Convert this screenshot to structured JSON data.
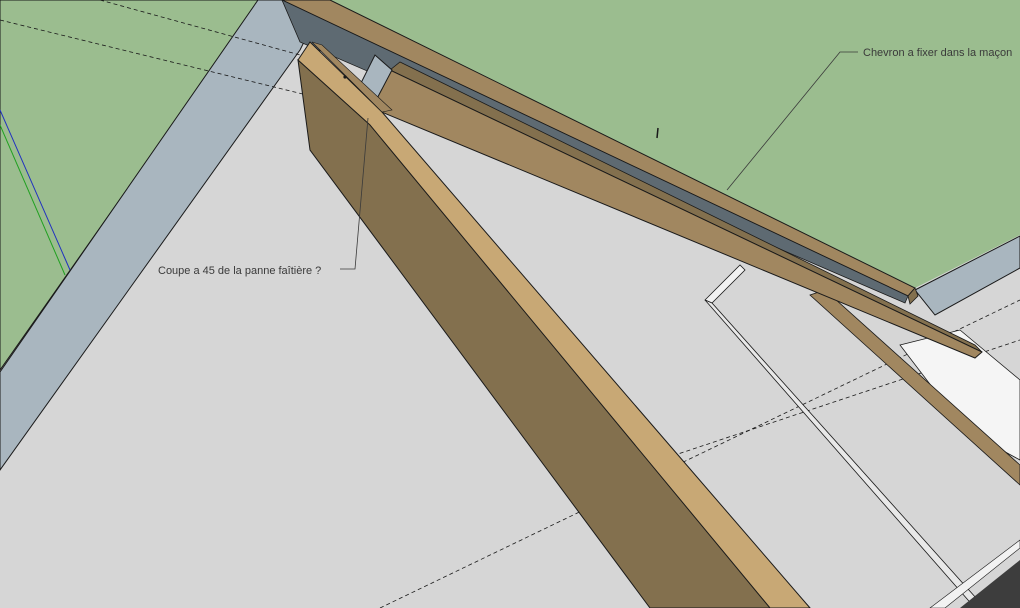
{
  "annotations": {
    "chevron_label": "Chevron a fixer dans la maçon",
    "cut_label": "Coupe a  45 de la panne faîtière ?"
  },
  "colors": {
    "ground": "#d6d6d6",
    "roof_green": "#9bbd8f",
    "wall_blue_grey": "#a9b6bf",
    "wood_light": "#c8a875",
    "wood_medium": "#a18760",
    "wood_dark": "#83704e",
    "white_surface": "#f5f5f5",
    "dark_floor": "#3d3d3d",
    "edge": "#1a1a1a",
    "axis_blue": "#2030c0",
    "axis_green": "#20a020"
  }
}
